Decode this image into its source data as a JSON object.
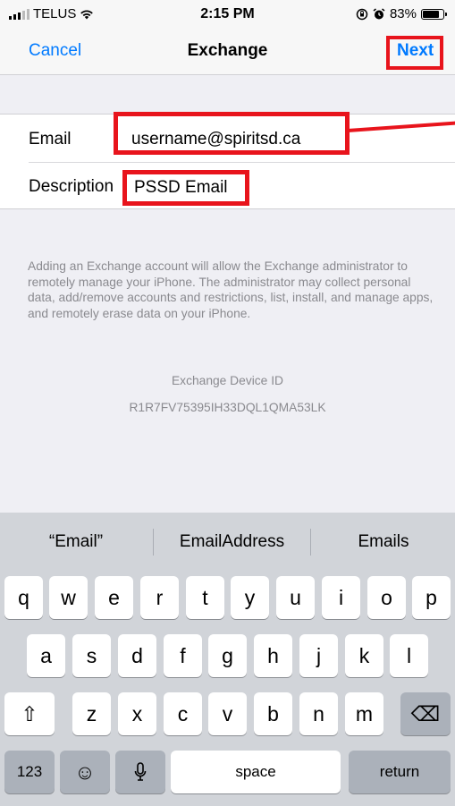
{
  "status_bar": {
    "carrier": "TELUS",
    "time": "2:15 PM",
    "battery": "83%",
    "battery_level": 0.83
  },
  "nav": {
    "cancel": "Cancel",
    "title": "Exchange",
    "next": "Next"
  },
  "form": {
    "email_label": "Email",
    "email_value": "username@spiritsd.ca",
    "description_label": "Description",
    "description_value": "PSSD Email"
  },
  "info": {
    "text": "Adding an Exchange account will allow the Exchange administrator to remotely manage your iPhone. The administrator may collect personal data, add/remove accounts and restrictions, list, install, and manage apps, and remotely erase data on your iPhone.",
    "device_id_label": "Exchange Device ID",
    "device_id_value": "R1R7FV75395IH33DQL1QMA53LK"
  },
  "keyboard": {
    "suggestions": [
      "“Email”",
      "EmailAddress",
      "Emails"
    ],
    "row1": [
      "q",
      "w",
      "e",
      "r",
      "t",
      "y",
      "u",
      "i",
      "o",
      "p"
    ],
    "row2": [
      "a",
      "s",
      "d",
      "f",
      "g",
      "h",
      "j",
      "k",
      "l"
    ],
    "row3": [
      "z",
      "x",
      "c",
      "v",
      "b",
      "n",
      "m"
    ],
    "shift_glyph": "⇧",
    "delete_glyph": "⌫",
    "numbers_label": "123",
    "emoji_glyph": "☺",
    "space_label": "space",
    "return_label": "return"
  },
  "icons": {
    "wifi": "wifi-icon",
    "lock_rotation": "rotation-lock-icon",
    "alarm": "alarm-icon",
    "microphone": "microphone-icon"
  },
  "colors": {
    "accent": "#007aff",
    "highlight": "#e8141c",
    "keyboard_bg": "#d1d4d9"
  }
}
